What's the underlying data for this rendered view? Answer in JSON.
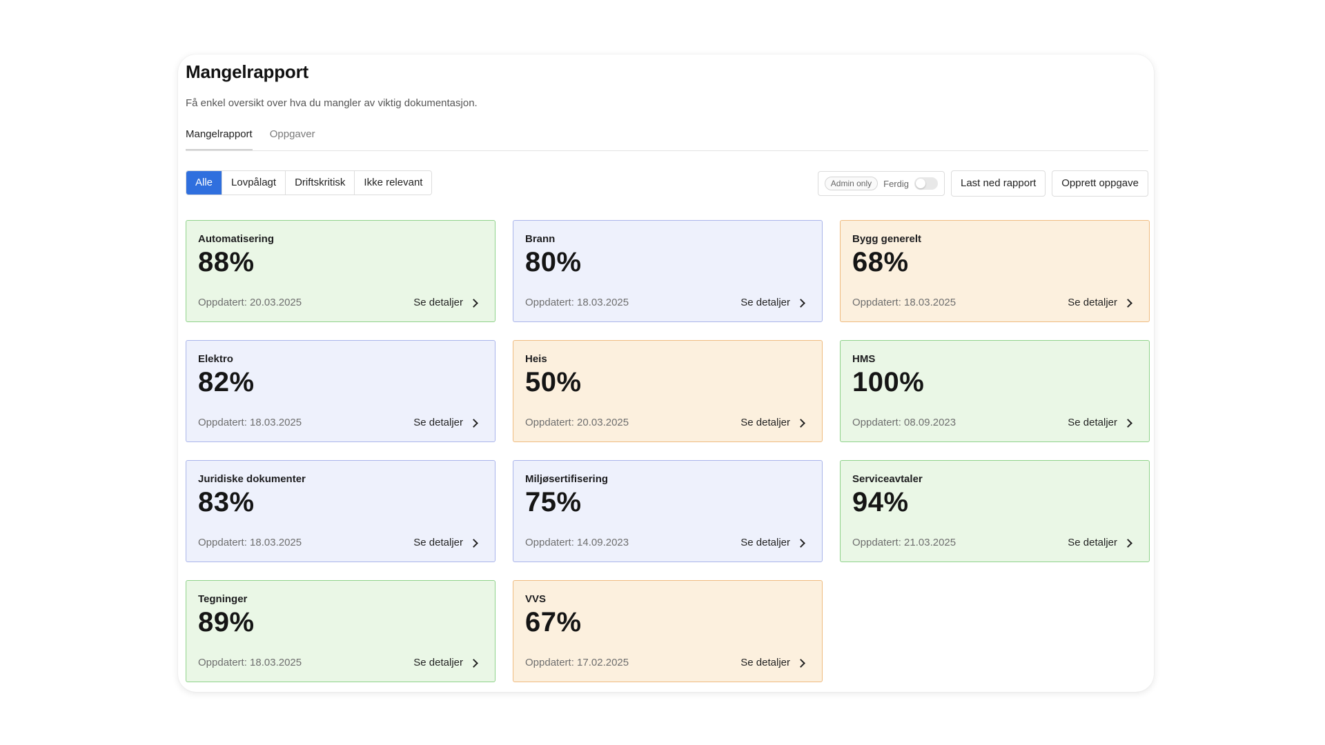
{
  "header": {
    "title": "Mangelrapport",
    "subtitle": "Få enkel oversikt over hva du mangler av viktig dokumentasjon."
  },
  "tabs": [
    {
      "label": "Mangelrapport",
      "active": true
    },
    {
      "label": "Oppgaver",
      "active": false
    }
  ],
  "filters": [
    {
      "label": "Alle",
      "active": true
    },
    {
      "label": "Lovpålagt",
      "active": false
    },
    {
      "label": "Driftskritisk",
      "active": false
    },
    {
      "label": "Ikke relevant",
      "active": false
    }
  ],
  "controls": {
    "admin_badge": "Admin only",
    "ferdig_label": "Ferdig",
    "ferdig_toggle_on": false,
    "download_label": "Last ned rapport",
    "create_task_label": "Opprett oppgave"
  },
  "colors": {
    "accent": "#2f6fde",
    "green_bg": "#eaf7e6",
    "blue_bg": "#eef1fc",
    "orange_bg": "#fcf0de"
  },
  "cards": [
    {
      "title": "Automatisering",
      "percent": "88%",
      "updated": "Oppdatert: 20.03.2025",
      "details": "Se detaljer",
      "status": "green"
    },
    {
      "title": "Brann",
      "percent": "80%",
      "updated": "Oppdatert: 18.03.2025",
      "details": "Se detaljer",
      "status": "blue"
    },
    {
      "title": "Bygg generelt",
      "percent": "68%",
      "updated": "Oppdatert: 18.03.2025",
      "details": "Se detaljer",
      "status": "orange"
    },
    {
      "title": "Elektro",
      "percent": "82%",
      "updated": "Oppdatert: 18.03.2025",
      "details": "Se detaljer",
      "status": "blue"
    },
    {
      "title": "Heis",
      "percent": "50%",
      "updated": "Oppdatert: 20.03.2025",
      "details": "Se detaljer",
      "status": "orange"
    },
    {
      "title": "HMS",
      "percent": "100%",
      "updated": "Oppdatert: 08.09.2023",
      "details": "Se detaljer",
      "status": "green"
    },
    {
      "title": "Juridiske dokumenter",
      "percent": "83%",
      "updated": "Oppdatert: 18.03.2025",
      "details": "Se detaljer",
      "status": "blue"
    },
    {
      "title": "Miljøsertifisering",
      "percent": "75%",
      "updated": "Oppdatert: 14.09.2023",
      "details": "Se detaljer",
      "status": "blue"
    },
    {
      "title": "Serviceavtaler",
      "percent": "94%",
      "updated": "Oppdatert: 21.03.2025",
      "details": "Se detaljer",
      "status": "green"
    },
    {
      "title": "Tegninger",
      "percent": "89%",
      "updated": "Oppdatert: 18.03.2025",
      "details": "Se detaljer",
      "status": "green"
    },
    {
      "title": "VVS",
      "percent": "67%",
      "updated": "Oppdatert: 17.02.2025",
      "details": "Se detaljer",
      "status": "orange"
    }
  ]
}
